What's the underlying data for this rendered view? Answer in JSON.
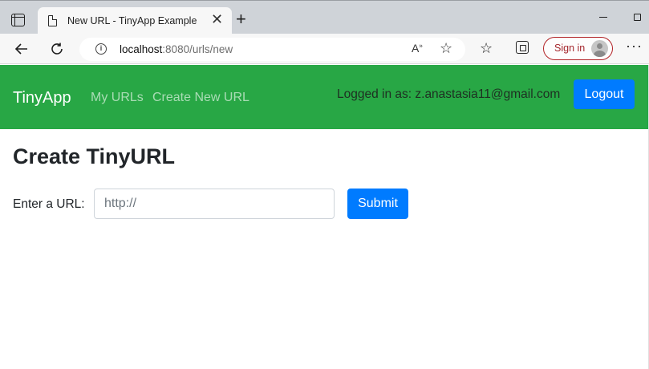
{
  "browser": {
    "tab_title": "New URL - TinyApp Example",
    "tab_close": "✕",
    "new_tab": "+",
    "address": {
      "host": "localhost",
      "path": ":8080/urls/new"
    },
    "sign_in_label": "Sign in",
    "more_label": "···"
  },
  "navbar": {
    "brand": "TinyApp",
    "links": [
      "My URLs",
      "Create New URL"
    ],
    "logged_in_text": "Logged in as: z.anastasia11@gmail.com",
    "logout_label": "Logout",
    "color": "#28a745"
  },
  "main": {
    "title": "Create TinyURL",
    "url_label": "Enter a URL:",
    "url_placeholder": "http://",
    "url_value": "",
    "submit_label": "Submit",
    "button_color": "#007bff"
  },
  "icons": [
    "tab-actions-icon",
    "page-icon",
    "back-arrow-icon",
    "refresh-icon",
    "info-icon",
    "read-aloud-icon",
    "add-favorite-icon",
    "favorites-icon",
    "collections-icon",
    "avatar-icon",
    "more-icon",
    "minimize-icon",
    "maximize-icon"
  ]
}
